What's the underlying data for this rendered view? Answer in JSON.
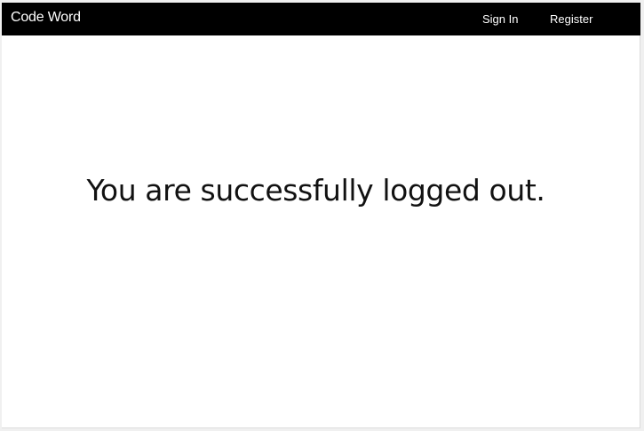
{
  "navbar": {
    "brand": "Code Word",
    "links": {
      "sign_in": "Sign In",
      "register": "Register"
    }
  },
  "main": {
    "message": "You are successfully logged out."
  },
  "colors": {
    "navbar_background": "#000000",
    "navbar_text": "#ffffff",
    "page_background": "#ffffff",
    "message_text": "#111111"
  }
}
